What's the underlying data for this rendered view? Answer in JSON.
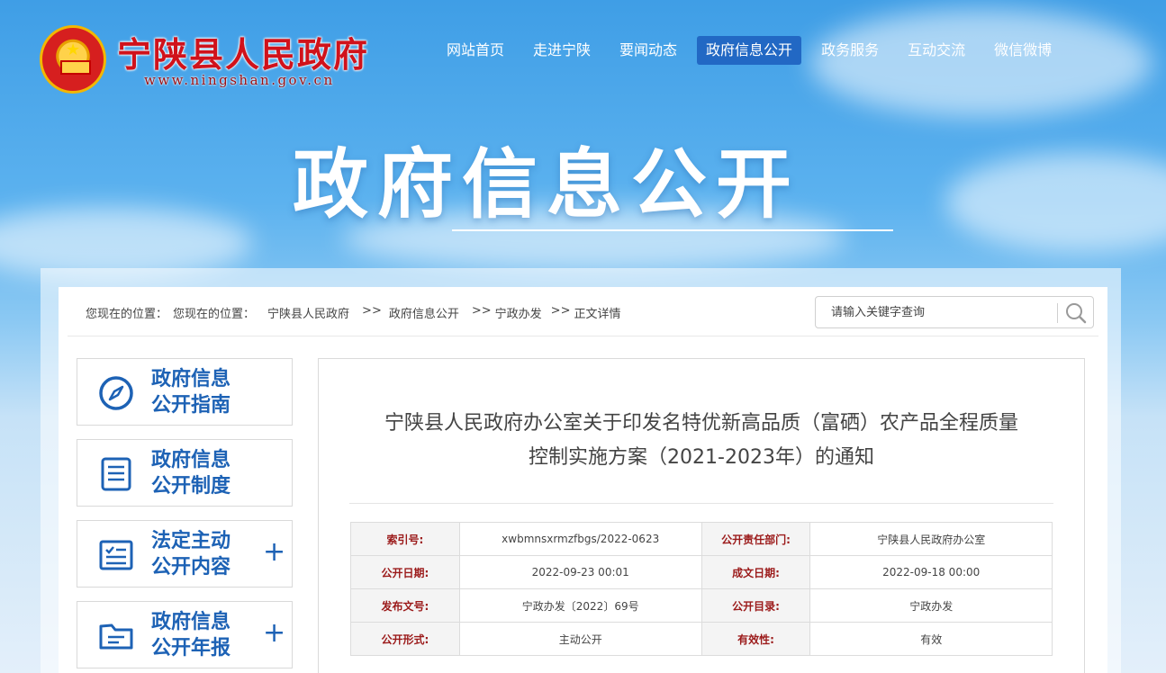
{
  "header": {
    "site_title": "宁陕县人民政府",
    "site_url": "www.ningshan.gov.cn",
    "nav": [
      {
        "label": "网站首页",
        "active": false
      },
      {
        "label": "走进宁陕",
        "active": false
      },
      {
        "label": "要闻动态",
        "active": false
      },
      {
        "label": "政府信息公开",
        "active": true
      },
      {
        "label": "政务服务",
        "active": false
      },
      {
        "label": "互动交流",
        "active": false
      },
      {
        "label": "微信微博",
        "active": false
      }
    ],
    "hero_title": "政府信息公开"
  },
  "breadcrumb": {
    "prefix": "您现在的位置：",
    "prefix2": "您现在的位置：",
    "items": [
      "宁陕县人民政府",
      ">>",
      "政府信息公开",
      ">>",
      "宁政办发",
      ">>",
      "正文详情"
    ]
  },
  "search": {
    "placeholder": "请输入关键字查询"
  },
  "sidebar": {
    "items": [
      {
        "line1": "政府信息",
        "line2": "公开指南",
        "icon": "compass-icon",
        "expandable": false
      },
      {
        "line1": "政府信息",
        "line2": "公开制度",
        "icon": "document-list-icon",
        "expandable": false
      },
      {
        "line1": "法定主动",
        "line2": "公开内容",
        "icon": "checklist-icon",
        "expandable": true
      },
      {
        "line1": "政府信息",
        "line2": "公开年报",
        "icon": "folder-icon",
        "expandable": true
      }
    ],
    "plus_symbol": "+"
  },
  "article": {
    "title_line1": "宁陕县人民政府办公室关于印发名特优新高品质（富硒）农产品全程质量",
    "title_line2": "控制实施方案（2021-2023年）的通知",
    "meta": [
      {
        "k1": "索引号:",
        "v1": "xwbmnsxrmzfbgs/2022-0623",
        "k2": "公开责任部门:",
        "v2": "宁陕县人民政府办公室"
      },
      {
        "k1": "公开日期:",
        "v1": "2022-09-23 00:01",
        "k2": "成文日期:",
        "v2": "2022-09-18 00:00"
      },
      {
        "k1": "发布文号:",
        "v1": "宁政办发〔2022〕69号",
        "k2": "公开目录:",
        "v2": "宁政办发"
      },
      {
        "k1": "公开形式:",
        "v1": "主动公开",
        "k2": "有效性:",
        "v2": "有效"
      }
    ]
  },
  "colors": {
    "title_red": "#d0121b",
    "nav_active_bg": "#2268c4",
    "sidebar_blue": "#1d62b5"
  }
}
